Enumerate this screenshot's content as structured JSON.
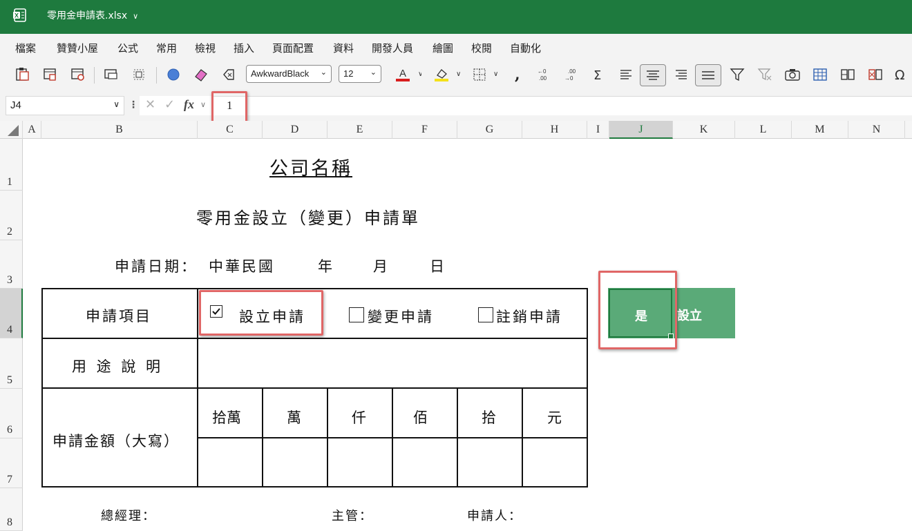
{
  "window": {
    "filename": "零用金申請表.xlsx"
  },
  "menu": [
    "檔案",
    "贊贊小屋",
    "公式",
    "常用",
    "檢視",
    "插入",
    "頁面配置",
    "資料",
    "開發人員",
    "繪圖",
    "校閱",
    "自動化"
  ],
  "toolbar": {
    "font_name": "AwkwardBlack",
    "font_size": "12"
  },
  "formula_bar": {
    "name_box": "J4",
    "fx": "fx",
    "content": "1"
  },
  "columns": [
    "A",
    "B",
    "C",
    "D",
    "E",
    "F",
    "G",
    "H",
    "I",
    "J",
    "K",
    "L",
    "M",
    "N"
  ],
  "rows": [
    "1",
    "2",
    "3",
    "4",
    "5",
    "6",
    "7",
    "8"
  ],
  "selected_cell": "J4",
  "sheet": {
    "company": "公司名稱",
    "form_title": "零用金設立（變更）申請單",
    "apply_date_label": "申請日期：",
    "roc": "中華民國",
    "year": "年",
    "month": "月",
    "day": "日",
    "item_label": "申請項目",
    "opt_setup": "設立申請",
    "opt_change": "變更申請",
    "opt_cancel": "註銷申請",
    "purpose_label": "用 途 說 明",
    "amount_label": "申請金額（大寫）",
    "units": [
      "拾萬",
      "萬",
      "仟",
      "佰",
      "拾",
      "元"
    ],
    "gm_label": "總經理：",
    "supervisor_label": "主管：",
    "applicant_label": "申請人："
  },
  "button": {
    "yes_label": "是",
    "setup_label": "設立"
  },
  "colors": {
    "excel_green": "#1e7a3e",
    "button_green": "#5aaa78",
    "highlight_red": "#e06666"
  }
}
